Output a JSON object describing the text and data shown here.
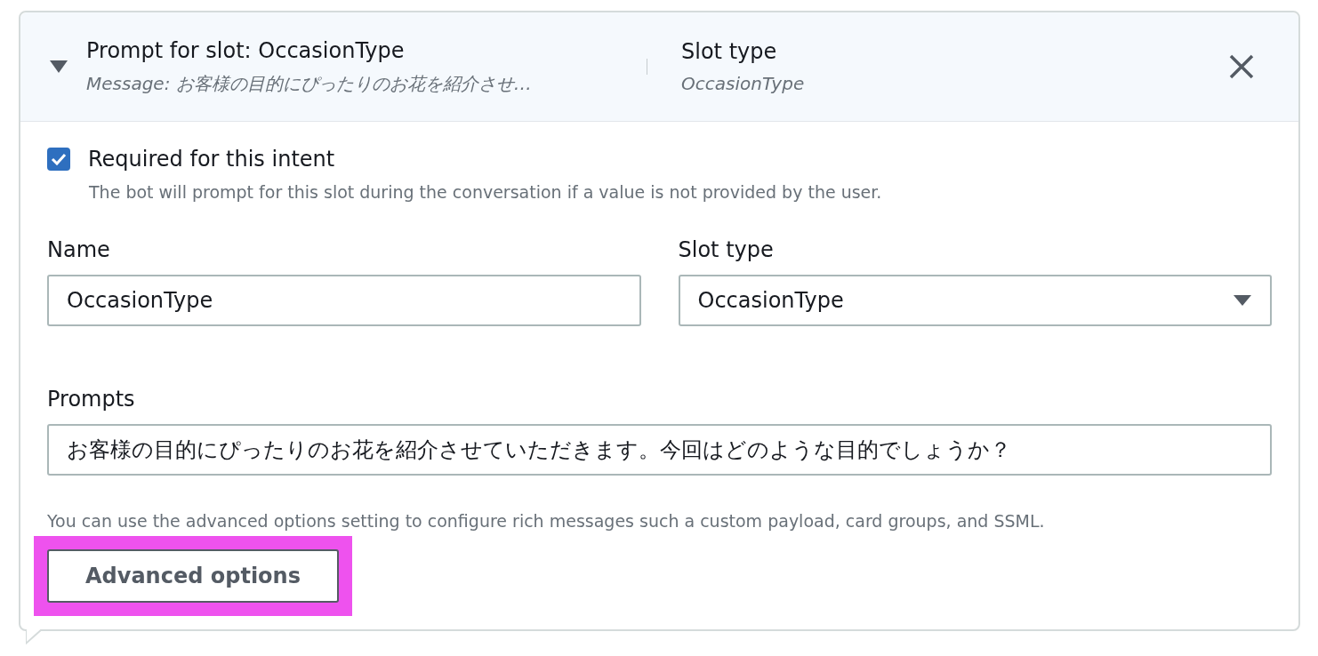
{
  "header": {
    "expanded": true,
    "title": "Prompt for slot: OccasionType",
    "message": "*Message:* お客様の目的にぴったりのお花を紹介させ…",
    "slot_type_label": "Slot type",
    "slot_type_value": "OccasionType"
  },
  "required": {
    "checked": true,
    "label": "Required for this intent",
    "description": "The bot will prompt for this slot during the conversation if a value is not provided by the user."
  },
  "name_field": {
    "label": "Name",
    "value": "OccasionType"
  },
  "slot_type_field": {
    "label": "Slot type",
    "value": "OccasionType"
  },
  "prompts_field": {
    "label": "Prompts",
    "value": "お客様の目的にぴったりのお花を紹介させていただきます。今回はどのような目的でしょうか？"
  },
  "help_text": "You can use the advanced options setting to configure rich messages such a custom payload, card groups, and SSML.",
  "advanced_button": {
    "label": "Advanced options",
    "highlighted": true
  }
}
